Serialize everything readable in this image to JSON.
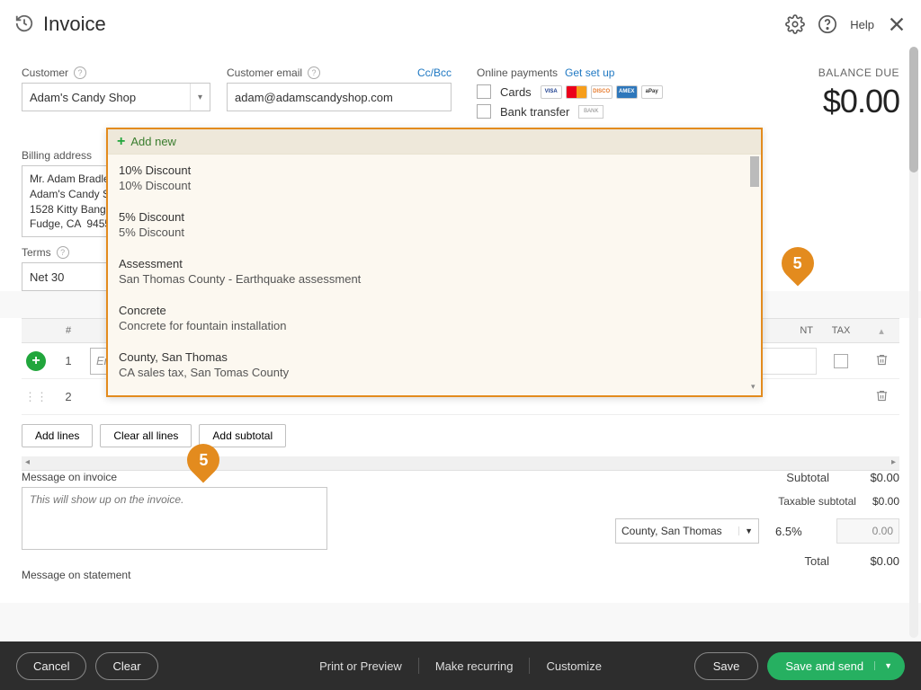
{
  "header": {
    "title": "Invoice",
    "help": "Help"
  },
  "customer": {
    "label": "Customer",
    "value": "Adam's Candy Shop",
    "email_label": "Customer email",
    "email_value": "adam@adamscandyshop.com",
    "ccbcc": "Cc/Bcc"
  },
  "online": {
    "label": "Online payments",
    "setup": "Get set up",
    "cards": "Cards",
    "bank": "Bank transfer",
    "badges": {
      "visa": "VISA",
      "mc": "",
      "disc": "DISCO",
      "amex": "AMEX",
      "apay": "aPay",
      "bank": "BANK"
    }
  },
  "balance": {
    "label": "BALANCE DUE",
    "amount": "$0.00"
  },
  "billing": {
    "label": "Billing address",
    "text": "Mr. Adam Bradley\nAdam's Candy Shop\n1528 Kitty Bang Bang\nFudge, CA  94555"
  },
  "terms": {
    "label": "Terms",
    "value": "Net 30"
  },
  "grid": {
    "headers": {
      "num": "#",
      "prod": "",
      "desc": "",
      "qty": "",
      "rate": "",
      "amt": "NT",
      "tax": "TAX"
    },
    "row1": {
      "num": "1",
      "placeholder": "Enter Text"
    },
    "row2": {
      "num": "2"
    },
    "buttons": {
      "add": "Add lines",
      "clear": "Clear all lines",
      "sub": "Add subtotal"
    }
  },
  "messages": {
    "invoice_label": "Message on invoice",
    "invoice_placeholder": "This will show up on the invoice.",
    "statement_label": "Message on statement"
  },
  "totals": {
    "subtotal_label": "Subtotal",
    "subtotal": "$0.00",
    "taxable_label": "Taxable subtotal",
    "taxable": "$0.00",
    "tax_region": "County, San Thomas",
    "tax_pct": "6.5%",
    "tax_amt": "0.00",
    "total_label": "Total",
    "total": "$0.00"
  },
  "footer": {
    "cancel": "Cancel",
    "clear": "Clear",
    "print": "Print or Preview",
    "recur": "Make recurring",
    "cust": "Customize",
    "save": "Save",
    "send": "Save and send"
  },
  "dropdown": {
    "addnew": "Add new",
    "items": [
      {
        "t1": "10% Discount",
        "t2": "10% Discount"
      },
      {
        "t1": "5% Discount",
        "t2": "5% Discount"
      },
      {
        "t1": "Assessment",
        "t2": "San Thomas County - Earthquake assessment"
      },
      {
        "t1": "Concrete",
        "t2": "Concrete for fountain installation"
      },
      {
        "t1": "County, San Thomas",
        "t2": "CA sales tax, San Tomas County"
      }
    ]
  },
  "callouts": {
    "n": "5"
  }
}
